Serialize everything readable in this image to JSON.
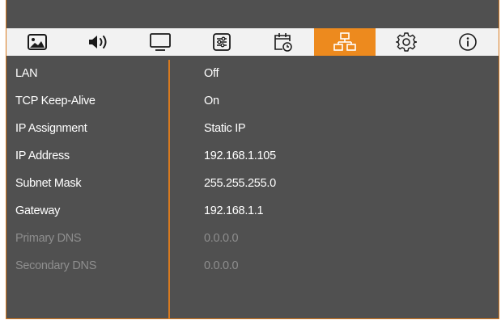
{
  "tabs": [
    {
      "icon": "picture-icon",
      "active": false
    },
    {
      "icon": "speaker-icon",
      "active": false
    },
    {
      "icon": "monitor-icon",
      "active": false
    },
    {
      "icon": "sliders-icon",
      "active": false
    },
    {
      "icon": "calendar-clock-icon",
      "active": false
    },
    {
      "icon": "network-icon",
      "active": true
    },
    {
      "icon": "gear-icon",
      "active": false
    },
    {
      "icon": "info-icon",
      "active": false
    }
  ],
  "colors": {
    "accent": "#ed8a1e",
    "panel": "#505050",
    "tab_bar": "#f2f2f2",
    "text": "#ffffff",
    "disabled_text": "#8e8e8e"
  },
  "settings": [
    {
      "label": "LAN",
      "value": "Off",
      "enabled": true
    },
    {
      "label": "TCP Keep-Alive",
      "value": "On",
      "enabled": true
    },
    {
      "label": "IP Assignment",
      "value": "Static IP",
      "enabled": true
    },
    {
      "label": "IP Address",
      "value": "192.168.1.105",
      "enabled": true
    },
    {
      "label": "Subnet Mask",
      "value": "255.255.255.0",
      "enabled": true
    },
    {
      "label": "Gateway",
      "value": "192.168.1.1",
      "enabled": true
    },
    {
      "label": "Primary DNS",
      "value": "0.0.0.0",
      "enabled": false
    },
    {
      "label": "Secondary DNS",
      "value": "0.0.0.0",
      "enabled": false
    }
  ]
}
